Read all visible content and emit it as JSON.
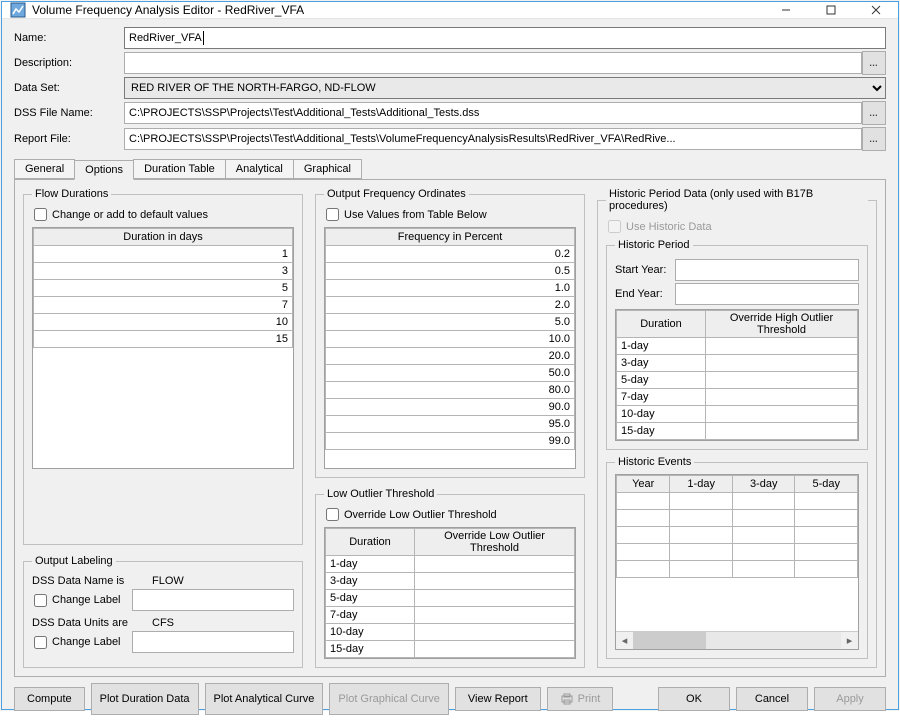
{
  "window_title": "Volume Frequency Analysis Editor - RedRiver_VFA",
  "labels": {
    "name": "Name:",
    "description": "Description:",
    "data_set": "Data Set:",
    "dss_file": "DSS File Name:",
    "report_file": "Report File:"
  },
  "values": {
    "name": "RedRiver_VFA",
    "description": "",
    "data_set": "RED RIVER OF THE NORTH-FARGO, ND-FLOW",
    "dss_file": "C:\\PROJECTS\\SSP\\Projects\\Test\\Additional_Tests\\Additional_Tests.dss",
    "report_file": "C:\\PROJECTS\\SSP\\Projects\\Test\\Additional_Tests\\VolumeFrequencyAnalysisResults\\RedRiver_VFA\\RedRive..."
  },
  "tabs": [
    "General",
    "Options",
    "Duration Table",
    "Analytical",
    "Graphical"
  ],
  "active_tab": "Options",
  "flow_durations": {
    "legend": "Flow Durations",
    "change_label": "Change or add to default values",
    "col": "Duration in days",
    "rows": [
      "1",
      "3",
      "5",
      "7",
      "10",
      "15"
    ]
  },
  "output_labeling": {
    "legend": "Output Labeling",
    "line1_prefix": "DSS Data Name is",
    "line1_val": "FLOW",
    "change_label": "Change Label",
    "line2_prefix": "DSS Data Units are",
    "line2_val": "CFS"
  },
  "output_freq": {
    "legend": "Output Frequency Ordinates",
    "use_label": "Use Values from Table Below",
    "col": "Frequency in Percent",
    "rows": [
      "0.2",
      "0.5",
      "1.0",
      "2.0",
      "5.0",
      "10.0",
      "20.0",
      "50.0",
      "80.0",
      "90.0",
      "95.0",
      "99.0"
    ]
  },
  "low_outlier": {
    "legend": "Low Outlier Threshold",
    "override": "Override Low Outlier Threshold",
    "cols": [
      "Duration",
      "Override Low Outlier Threshold"
    ],
    "rows": [
      "1-day",
      "3-day",
      "5-day",
      "7-day",
      "10-day",
      "15-day"
    ]
  },
  "historic": {
    "legend": "Historic Period Data (only used with B17B procedures)",
    "use_label": "Use Historic Data",
    "period_legend": "Historic Period",
    "start_year": "Start Year:",
    "end_year": "End Year:",
    "thresh_cols": [
      "Duration",
      "Override High Outlier Threshold"
    ],
    "thresh_rows": [
      "1-day",
      "3-day",
      "5-day",
      "7-day",
      "10-day",
      "15-day"
    ],
    "events_legend": "Historic Events",
    "events_cols": [
      "Year",
      "1-day",
      "3-day",
      "5-day"
    ]
  },
  "buttons": {
    "compute": "Compute",
    "plot_dur": "Plot Duration Data",
    "plot_ana": "Plot Analytical Curve",
    "plot_gra": "Plot Graphical Curve",
    "view_rep": "View Report",
    "print": "Print",
    "ok": "OK",
    "cancel": "Cancel",
    "apply": "Apply"
  }
}
